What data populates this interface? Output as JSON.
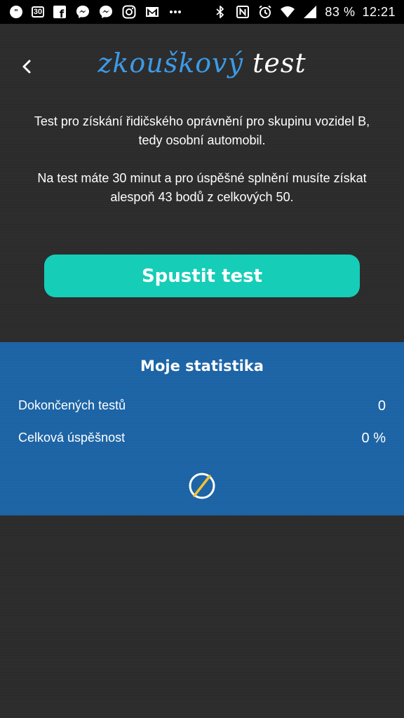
{
  "status_bar": {
    "calendar_day": "30",
    "battery": "83 %",
    "time": "12:21",
    "left_icons": [
      "chat-bubble-icon",
      "calendar-icon",
      "facebook-icon",
      "messenger-icon",
      "messenger-icon",
      "instagram-icon",
      "gmail-icon",
      "more-dots-icon"
    ],
    "right_icons": [
      "bluetooth-icon",
      "nfc-icon",
      "alarm-icon",
      "wifi-icon",
      "signal-icon"
    ]
  },
  "header": {
    "title_part1": "zkouškový",
    "title_part2": "test",
    "back_icon": "chevron-left-icon"
  },
  "intro": {
    "paragraph1": "Test  pro získání řidičského oprávnění pro skupinu vozidel B, tedy osobní automobil.",
    "paragraph2": "Na test máte 30 minut a pro úspěšné splnění musíte získat alespoň 43 bodů z celkových 50."
  },
  "start_button": {
    "label": "Spustit test"
  },
  "stats": {
    "title": "Moje statistika",
    "rows": [
      {
        "label": "Dokončených testů",
        "value": "0"
      },
      {
        "label": "Celková úspěšnost",
        "value": "0 %"
      }
    ],
    "icon": "no-data-icon"
  },
  "colors": {
    "background": "#2c2c2c",
    "accent_blue": "#3d9ae6",
    "button_teal": "#16cdb8",
    "stats_panel": "#1b63a5",
    "icon_yellow": "#f2c230"
  }
}
